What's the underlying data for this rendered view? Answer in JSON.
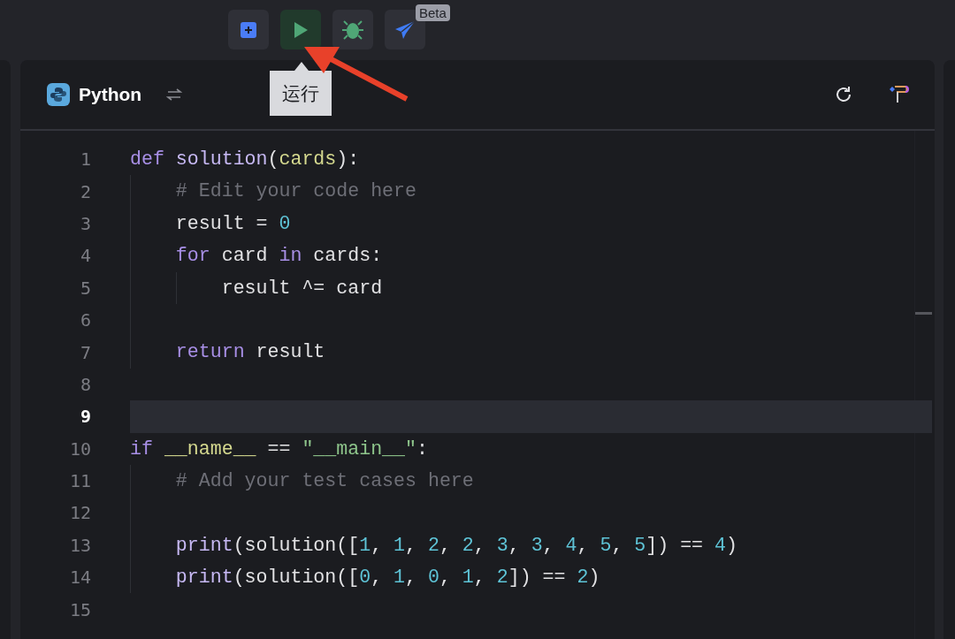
{
  "toolbar": {
    "buttons": [
      {
        "kind": "add",
        "selected": false
      },
      {
        "kind": "run",
        "selected": true
      },
      {
        "kind": "debug",
        "selected": false
      },
      {
        "kind": "submit",
        "selected": false,
        "badge": "Beta"
      }
    ],
    "tooltip": "运行"
  },
  "editor": {
    "language": "Python",
    "lines": [
      {
        "number": "1",
        "current": false,
        "tokens": [
          {
            "text": "def ",
            "kind": "keyword"
          },
          {
            "text": "solution",
            "kind": "function"
          },
          {
            "text": "(",
            "kind": "plain"
          },
          {
            "text": "cards",
            "kind": "param"
          },
          {
            "text": "):",
            "kind": "plain"
          }
        ]
      },
      {
        "number": "2",
        "current": false,
        "tokens": [
          {
            "text": "    # Edit your code here",
            "kind": "comment"
          }
        ]
      },
      {
        "number": "3",
        "current": false,
        "tokens": [
          {
            "text": "    result = ",
            "kind": "plain"
          },
          {
            "text": "0",
            "kind": "number"
          }
        ]
      },
      {
        "number": "4",
        "current": false,
        "tokens": [
          {
            "text": "    for",
            "kind": "keyword"
          },
          {
            "text": " card ",
            "kind": "plain"
          },
          {
            "text": "in",
            "kind": "keyword"
          },
          {
            "text": " cards:",
            "kind": "plain"
          }
        ]
      },
      {
        "number": "5",
        "current": false,
        "tokens": [
          {
            "text": "        result ^= card",
            "kind": "plain"
          }
        ]
      },
      {
        "number": "6",
        "current": false
      },
      {
        "number": "7",
        "current": false,
        "tokens": [
          {
            "text": "    return",
            "kind": "keyword"
          },
          {
            "text": " result",
            "kind": "plain"
          }
        ]
      },
      {
        "number": "8",
        "current": false
      },
      {
        "number": "9",
        "current": true
      },
      {
        "number": "10",
        "current": false,
        "tokens": [
          {
            "text": "if ",
            "kind": "keyword"
          },
          {
            "text": "__name__",
            "kind": "param"
          },
          {
            "text": " == ",
            "kind": "plain"
          },
          {
            "text": "\"__main__\"",
            "kind": "string"
          },
          {
            "text": ":",
            "kind": "plain"
          }
        ]
      },
      {
        "number": "11",
        "current": false,
        "tokens": [
          {
            "text": "    # Add your test cases here",
            "kind": "comment"
          }
        ]
      },
      {
        "number": "12",
        "current": false
      },
      {
        "number": "13",
        "current": false,
        "tokens": [
          {
            "text": "    print",
            "kind": "function"
          },
          {
            "text": "(solution([",
            "kind": "plain"
          },
          {
            "text": "1",
            "kind": "number"
          },
          {
            "text": ", ",
            "kind": "plain"
          },
          {
            "text": "1",
            "kind": "number"
          },
          {
            "text": ", ",
            "kind": "plain"
          },
          {
            "text": "2",
            "kind": "number"
          },
          {
            "text": ", ",
            "kind": "plain"
          },
          {
            "text": "2",
            "kind": "number"
          },
          {
            "text": ", ",
            "kind": "plain"
          },
          {
            "text": "3",
            "kind": "number"
          },
          {
            "text": ", ",
            "kind": "plain"
          },
          {
            "text": "3",
            "kind": "number"
          },
          {
            "text": ", ",
            "kind": "plain"
          },
          {
            "text": "4",
            "kind": "number"
          },
          {
            "text": ", ",
            "kind": "plain"
          },
          {
            "text": "5",
            "kind": "number"
          },
          {
            "text": ", ",
            "kind": "plain"
          },
          {
            "text": "5",
            "kind": "number"
          },
          {
            "text": "]) == ",
            "kind": "plain"
          },
          {
            "text": "4",
            "kind": "number"
          },
          {
            "text": ")",
            "kind": "plain"
          }
        ]
      },
      {
        "number": "14",
        "current": false,
        "tokens": [
          {
            "text": "    print",
            "kind": "function"
          },
          {
            "text": "(solution([",
            "kind": "plain"
          },
          {
            "text": "0",
            "kind": "number"
          },
          {
            "text": ", ",
            "kind": "plain"
          },
          {
            "text": "1",
            "kind": "number"
          },
          {
            "text": ", ",
            "kind": "plain"
          },
          {
            "text": "0",
            "kind": "number"
          },
          {
            "text": ", ",
            "kind": "plain"
          },
          {
            "text": "1",
            "kind": "number"
          },
          {
            "text": ", ",
            "kind": "plain"
          },
          {
            "text": "2",
            "kind": "number"
          },
          {
            "text": "]) == ",
            "kind": "plain"
          },
          {
            "text": "2",
            "kind": "number"
          },
          {
            "text": ")",
            "kind": "plain"
          }
        ]
      },
      {
        "number": "15",
        "current": false
      }
    ]
  }
}
